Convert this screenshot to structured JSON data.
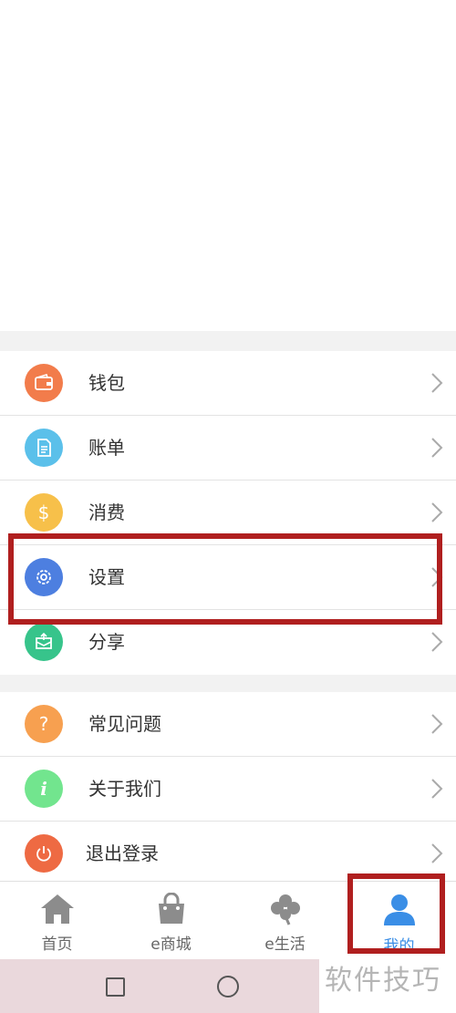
{
  "menu_group_1": [
    {
      "label": "钱包",
      "icon": "wallet-icon",
      "color": "#f27c4b"
    },
    {
      "label": "账单",
      "icon": "document-icon",
      "color": "#5bc0ea"
    },
    {
      "label": "消费",
      "icon": "dollar-icon",
      "color": "#f7c04a"
    },
    {
      "label": "设置",
      "icon": "gear-icon",
      "color": "#4d7fe0"
    },
    {
      "label": "分享",
      "icon": "share-mail-icon",
      "color": "#37c48b"
    }
  ],
  "menu_group_2": [
    {
      "label": "常见问题",
      "icon": "question-icon",
      "color": "#f7a050"
    },
    {
      "label": "关于我们",
      "icon": "info-icon",
      "color": "#72e58e"
    },
    {
      "label": "退出登录",
      "icon": "power-icon",
      "color": "#ee6a43"
    }
  ],
  "tabbar": {
    "tabs": [
      {
        "label": "首页",
        "icon": "home-icon"
      },
      {
        "label": "e商城",
        "icon": "shopping-bag-icon"
      },
      {
        "label": "e生活",
        "icon": "clover-icon"
      },
      {
        "label": "我的",
        "icon": "person-icon",
        "active": true
      }
    ]
  },
  "annotation_color": "#b01f1f",
  "watermark": "软件技巧"
}
